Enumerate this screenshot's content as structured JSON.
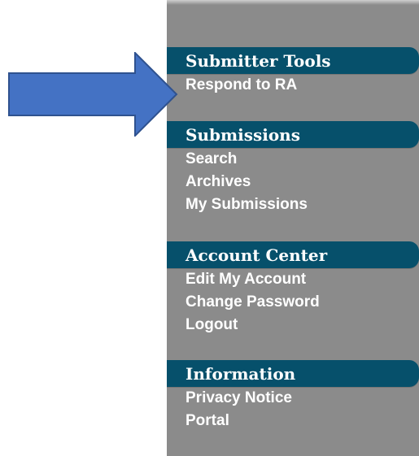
{
  "sidebar": {
    "sections": [
      {
        "title": "Submitter Tools",
        "items": [
          "Respond to RA"
        ]
      },
      {
        "title": "Submissions",
        "items": [
          "Search",
          "Archives",
          "My Submissions"
        ]
      },
      {
        "title": "Account Center",
        "items": [
          "Edit My Account",
          "Change Password",
          "Logout"
        ]
      },
      {
        "title": "Information",
        "items": [
          "Privacy Notice",
          "Portal"
        ]
      }
    ]
  },
  "annotation": {
    "arrow_icon": "right-arrow-icon",
    "arrow_color": "#4472c4",
    "arrow_border": "#2f528f"
  },
  "colors": {
    "sidebar_background": "#8b8b8b",
    "section_header_background": "#06506b",
    "text": "#ffffff"
  }
}
